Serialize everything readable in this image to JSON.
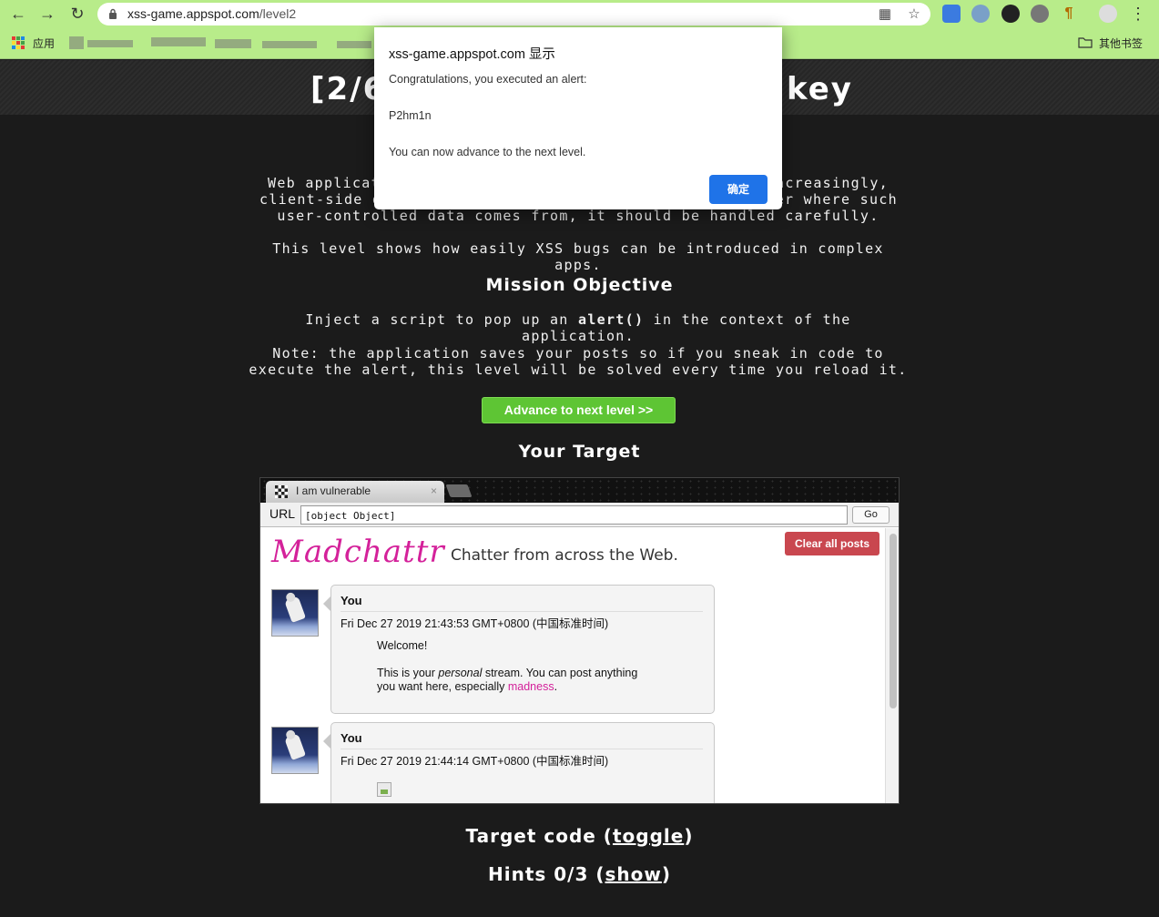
{
  "browser": {
    "url_prefix": "xss-game.appspot.com",
    "url_path": "/level2",
    "bookmarks": {
      "apps_label": "应用",
      "other_label": "其他书签"
    }
  },
  "page": {
    "heading_left": "[2/6",
    "heading_right": "key",
    "intro_line1": "Web applicat",
    "intro_line1_right": "ncreasingly,",
    "intro_line2": "client-side d",
    "intro_line2_right": "er where such",
    "intro_line3": "user-controlled data comes from, it should be handled carefully.",
    "level_note": "This level shows how easily XSS bugs can be introduced in complex apps.",
    "mission_title": "Mission Objective",
    "objective_pre": "Inject a script to pop up an",
    "objective_code": "alert()",
    "objective_post": "in the context of the application.",
    "note": "Note: the application saves your posts so if you sneak in code to execute the alert, this level will be solved every time you reload it.",
    "advance_label": "Advance to next level >>",
    "target_title": "Your Target",
    "code_title": "Target code (",
    "code_link": "toggle",
    "code_close": ")",
    "hints_title": "Hints 0/3 (",
    "hints_link": "show",
    "hints_close": ")"
  },
  "frame": {
    "tab_title": "I am vulnerable",
    "tab_close": "×",
    "url_label": "URL",
    "url_value": "[object Object]",
    "go_label": "Go",
    "logo": "Madchattr",
    "tagline": "Chatter from across the Web.",
    "clear_label": "Clear all posts",
    "posts": [
      {
        "author": "You",
        "date": "Fri Dec 27 2019 21:43:53 GMT+0800 (中国标准时间)",
        "welcome": "Welcome!",
        "body_pre": "This is your ",
        "body_em": "personal",
        "body_mid": " stream. You can post anything",
        "body_line2": "you want here, especially ",
        "body_link": "madness",
        "body_end": "."
      },
      {
        "author": "You",
        "date": "Fri Dec 27 2019 21:44:14 GMT+0800 (中国标准时间)"
      }
    ]
  },
  "alert": {
    "host": "xss-game.appspot.com 显示",
    "line1": "Congratulations, you executed an alert:",
    "line2": "P2hm1n",
    "line3": "You can now advance to the next level.",
    "ok_label": "确定"
  },
  "colors": {
    "chrome_bg": "#b8ec8a",
    "accent_green": "#5ec534",
    "madchattr_pink": "#d4219a",
    "clear_red": "#c9474f",
    "dialog_blue": "#1f73e8"
  }
}
